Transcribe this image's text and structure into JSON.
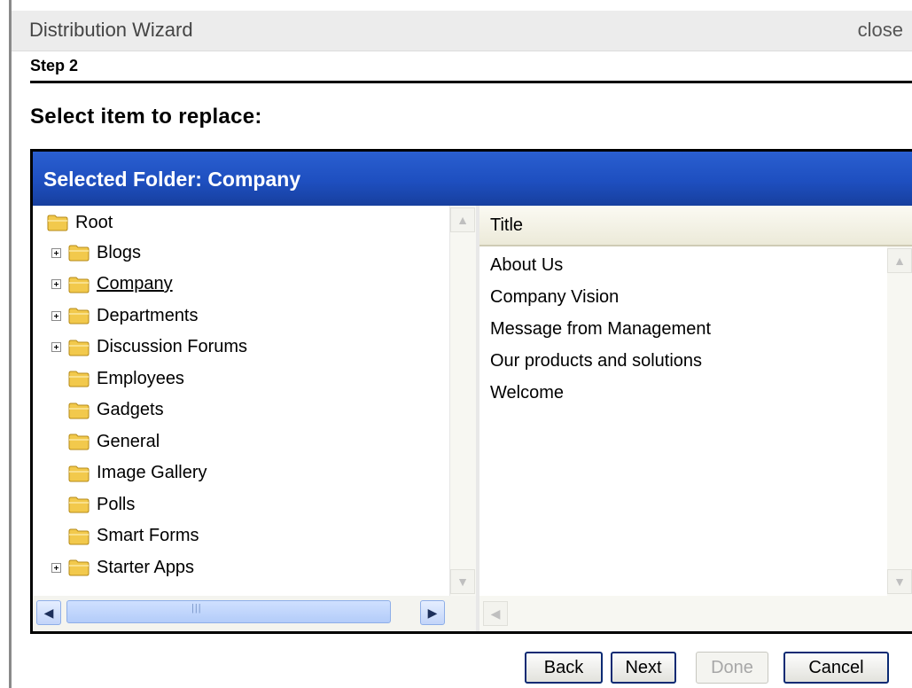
{
  "dialog": {
    "title": "Distribution Wizard",
    "close_label": "close"
  },
  "step_label": "Step 2",
  "heading": "Select item to replace:",
  "panel": {
    "header": "Selected Folder: Company"
  },
  "tree": {
    "root": "Root",
    "items": [
      {
        "label": "Blogs",
        "expandable": true
      },
      {
        "label": "Company",
        "expandable": true,
        "selected": true
      },
      {
        "label": "Departments",
        "expandable": true
      },
      {
        "label": "Discussion Forums",
        "expandable": true
      },
      {
        "label": "Employees",
        "expandable": false
      },
      {
        "label": "Gadgets",
        "expandable": false
      },
      {
        "label": "General",
        "expandable": false
      },
      {
        "label": "Image Gallery",
        "expandable": false
      },
      {
        "label": "Polls",
        "expandable": false
      },
      {
        "label": "Smart Forms",
        "expandable": false
      },
      {
        "label": "Starter Apps",
        "expandable": true
      }
    ]
  },
  "list": {
    "column_header": "Title",
    "items": [
      "About Us",
      "Company Vision",
      "Message from Management",
      "Our products and solutions",
      "Welcome"
    ]
  },
  "buttons": {
    "back": "Back",
    "next": "Next",
    "done": "Done",
    "cancel": "Cancel"
  },
  "icons": {
    "folder": "folder-icon",
    "expand": "plus-box-icon",
    "scroll_up": "arrow-up-icon",
    "scroll_down": "arrow-down-icon",
    "scroll_left": "arrow-left-icon",
    "scroll_right": "arrow-right-icon"
  },
  "colors": {
    "panel_header": "#1e4fc0",
    "folder": "#f2c94c",
    "button_border": "#0a2a73"
  }
}
